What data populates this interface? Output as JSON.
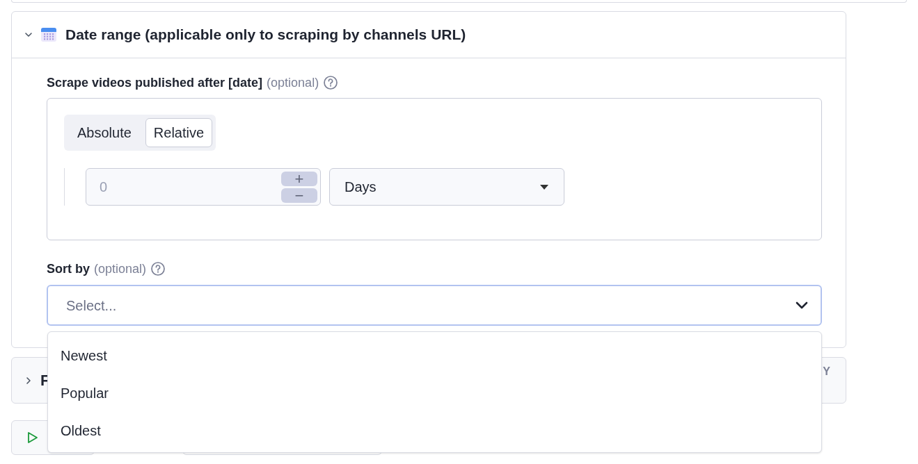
{
  "date_range_section": {
    "title": "Date range (applicable only to scraping by channels URL)",
    "expanded": true,
    "published_after": {
      "label": "Scrape videos published after [date]",
      "optional": "(optional)",
      "modes": [
        {
          "label": "Absolute",
          "selected": false
        },
        {
          "label": "Relative",
          "selected": true
        }
      ],
      "amount": {
        "placeholder": "0",
        "increment": "+",
        "decrement": "−"
      },
      "unit": {
        "value": "Days"
      }
    },
    "sort_by": {
      "label": "Sort by",
      "optional": "(optional)",
      "placeholder": "Select...",
      "expanded": true,
      "options": [
        "Newest",
        "Popular",
        "Oldest"
      ]
    }
  },
  "next_section": {
    "title": "F",
    "expanded": false,
    "badge": "Y"
  }
}
